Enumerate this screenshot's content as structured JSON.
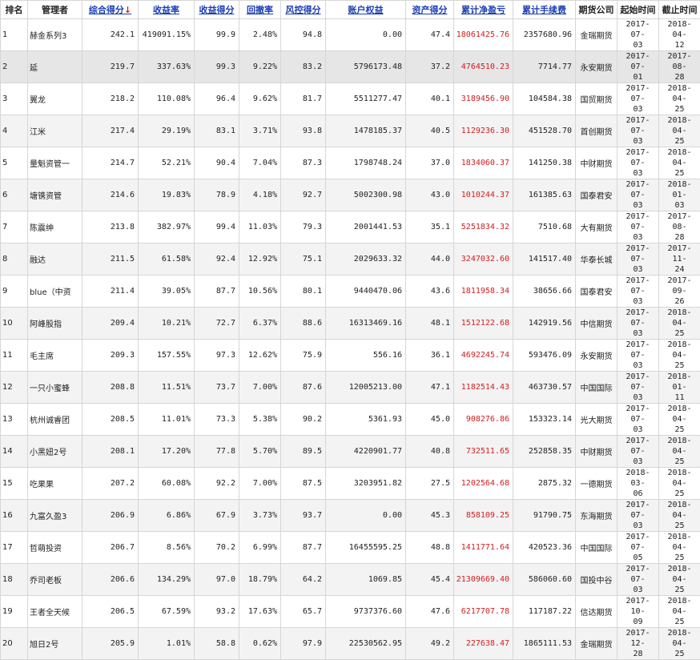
{
  "headers": {
    "rank": "排名",
    "manager": "管理者",
    "composite": "综合得分",
    "sort_arrow": "↓",
    "return_rate": "收益率",
    "return_score": "收益得分",
    "drawdown": "回撤率",
    "risk_score": "风控得分",
    "equity": "账户权益",
    "asset_score": "资产得分",
    "net_profit": "累计净盈亏",
    "fees": "累计手续费",
    "broker": "期货公司",
    "start": "起始时间",
    "end": "截止时间"
  },
  "rows": [
    {
      "rank": "1",
      "manager": "赫金系列3",
      "composite": "242.1",
      "ret": "419091.15%",
      "retScore": "99.9",
      "dd": "2.48%",
      "risk": "94.8",
      "equity": "0.00",
      "asset": "47.4",
      "profit": "18061425.76",
      "fee": "2357680.96",
      "broker": "金瑞期货",
      "start1": "2017-07-",
      "start2": "03",
      "end1": "2018-04-",
      "end2": "12"
    },
    {
      "rank": "2",
      "manager": "延",
      "composite": "219.7",
      "ret": "337.63%",
      "retScore": "99.3",
      "dd": "9.22%",
      "risk": "83.2",
      "equity": "5796173.48",
      "asset": "37.2",
      "profit": "4764510.23",
      "fee": "7714.77",
      "broker": "永安期货",
      "start1": "2017-07-",
      "start2": "01",
      "end1": "2017-08-",
      "end2": "28"
    },
    {
      "rank": "3",
      "manager": "翼龙",
      "composite": "218.2",
      "ret": "110.08%",
      "retScore": "96.4",
      "dd": "9.62%",
      "risk": "81.7",
      "equity": "5511277.47",
      "asset": "40.1",
      "profit": "3189456.90",
      "fee": "104584.38",
      "broker": "国贸期货",
      "start1": "2017-07-",
      "start2": "03",
      "end1": "2018-04-",
      "end2": "25"
    },
    {
      "rank": "4",
      "manager": "江米",
      "composite": "217.4",
      "ret": "29.19%",
      "retScore": "83.1",
      "dd": "3.71%",
      "risk": "93.8",
      "equity": "1478185.37",
      "asset": "40.5",
      "profit": "1129236.30",
      "fee": "451528.70",
      "broker": "首创期货",
      "start1": "2017-07-",
      "start2": "03",
      "end1": "2018-04-",
      "end2": "25"
    },
    {
      "rank": "5",
      "manager": "量魁资管一",
      "composite": "214.7",
      "ret": "52.21%",
      "retScore": "90.4",
      "dd": "7.04%",
      "risk": "87.3",
      "equity": "1798748.24",
      "asset": "37.0",
      "profit": "1834060.37",
      "fee": "141250.38",
      "broker": "中财期货",
      "start1": "2017-07-",
      "start2": "03",
      "end1": "2018-04-",
      "end2": "25"
    },
    {
      "rank": "6",
      "manager": "塘镌资管",
      "composite": "214.6",
      "ret": "19.83%",
      "retScore": "78.9",
      "dd": "4.18%",
      "risk": "92.7",
      "equity": "5002300.98",
      "asset": "43.0",
      "profit": "1010244.37",
      "fee": "161385.63",
      "broker": "国泰君安",
      "start1": "2017-07-",
      "start2": "03",
      "end1": "2018-01-",
      "end2": "03"
    },
    {
      "rank": "7",
      "manager": "陈震绅",
      "composite": "213.8",
      "ret": "382.97%",
      "retScore": "99.4",
      "dd": "11.03%",
      "risk": "79.3",
      "equity": "2001441.53",
      "asset": "35.1",
      "profit": "5251834.32",
      "fee": "7510.68",
      "broker": "大有期货",
      "start1": "2017-07-",
      "start2": "03",
      "end1": "2017-08-",
      "end2": "28"
    },
    {
      "rank": "8",
      "manager": "融达",
      "composite": "211.5",
      "ret": "61.58%",
      "retScore": "92.4",
      "dd": "12.92%",
      "risk": "75.1",
      "equity": "2029633.32",
      "asset": "44.0",
      "profit": "3247032.60",
      "fee": "141517.40",
      "broker": "华泰长城",
      "start1": "2017-07-",
      "start2": "03",
      "end1": "2017-11-",
      "end2": "24"
    },
    {
      "rank": "9",
      "manager": "blue（中资",
      "composite": "211.4",
      "ret": "39.05%",
      "retScore": "87.7",
      "dd": "10.56%",
      "risk": "80.1",
      "equity": "9440470.06",
      "asset": "43.6",
      "profit": "1811958.34",
      "fee": "38656.66",
      "broker": "国泰君安",
      "start1": "2017-07-",
      "start2": "03",
      "end1": "2017-09-",
      "end2": "26"
    },
    {
      "rank": "10",
      "manager": "阿峰股指",
      "composite": "209.4",
      "ret": "10.21%",
      "retScore": "72.7",
      "dd": "6.37%",
      "risk": "88.6",
      "equity": "16313469.16",
      "asset": "48.1",
      "profit": "1512122.68",
      "fee": "142919.56",
      "broker": "中信期货",
      "start1": "2017-07-",
      "start2": "03",
      "end1": "2018-04-",
      "end2": "25"
    },
    {
      "rank": "11",
      "manager": "毛主席",
      "composite": "209.3",
      "ret": "157.55%",
      "retScore": "97.3",
      "dd": "12.62%",
      "risk": "75.9",
      "equity": "556.16",
      "asset": "36.1",
      "profit": "4692245.74",
      "fee": "593476.09",
      "broker": "永安期货",
      "start1": "2017-07-",
      "start2": "03",
      "end1": "2018-04-",
      "end2": "25"
    },
    {
      "rank": "12",
      "manager": "一只小蜜蜂",
      "composite": "208.8",
      "ret": "11.51%",
      "retScore": "73.7",
      "dd": "7.00%",
      "risk": "87.6",
      "equity": "12005213.00",
      "asset": "47.1",
      "profit": "1182514.43",
      "fee": "463730.57",
      "broker": "中国国际",
      "start1": "2017-07-",
      "start2": "03",
      "end1": "2018-01-",
      "end2": "11"
    },
    {
      "rank": "13",
      "manager": "杭州诚睿团",
      "composite": "208.5",
      "ret": "11.01%",
      "retScore": "73.3",
      "dd": "5.38%",
      "risk": "90.2",
      "equity": "5361.93",
      "asset": "45.0",
      "profit": "908276.86",
      "fee": "153323.14",
      "broker": "光大期货",
      "start1": "2017-07-",
      "start2": "03",
      "end1": "2018-04-",
      "end2": "25"
    },
    {
      "rank": "14",
      "manager": "小黑妞2号",
      "composite": "208.1",
      "ret": "17.20%",
      "retScore": "77.8",
      "dd": "5.70%",
      "risk": "89.5",
      "equity": "4220901.77",
      "asset": "40.8",
      "profit": "732511.65",
      "fee": "252858.35",
      "broker": "中财期货",
      "start1": "2017-07-",
      "start2": "03",
      "end1": "2018-04-",
      "end2": "25"
    },
    {
      "rank": "15",
      "manager": "吃果果",
      "composite": "207.2",
      "ret": "60.08%",
      "retScore": "92.2",
      "dd": "7.00%",
      "risk": "87.5",
      "equity": "3203951.82",
      "asset": "27.5",
      "profit": "1202564.68",
      "fee": "2875.32",
      "broker": "一德期货",
      "start1": "2018-03-",
      "start2": "06",
      "end1": "2018-04-",
      "end2": "25"
    },
    {
      "rank": "16",
      "manager": "九富久盈3",
      "composite": "206.9",
      "ret": "6.86%",
      "retScore": "67.9",
      "dd": "3.73%",
      "risk": "93.7",
      "equity": "0.00",
      "asset": "45.3",
      "profit": "858109.25",
      "fee": "91790.75",
      "broker": "东海期货",
      "start1": "2017-07-",
      "start2": "03",
      "end1": "2018-04-",
      "end2": "25"
    },
    {
      "rank": "17",
      "manager": "哲萌投资",
      "composite": "206.7",
      "ret": "8.56%",
      "retScore": "70.2",
      "dd": "6.99%",
      "risk": "87.7",
      "equity": "16455595.25",
      "asset": "48.8",
      "profit": "1411771.64",
      "fee": "420523.36",
      "broker": "中国国际",
      "start1": "2017-07-",
      "start2": "05",
      "end1": "2018-04-",
      "end2": "25"
    },
    {
      "rank": "18",
      "manager": "乔司老板",
      "composite": "206.6",
      "ret": "134.29%",
      "retScore": "97.0",
      "dd": "18.79%",
      "risk": "64.2",
      "equity": "1069.85",
      "asset": "45.4",
      "profit": "21309669.40",
      "fee": "586060.60",
      "broker": "国投中谷",
      "start1": "2017-07-",
      "start2": "03",
      "end1": "2018-04-",
      "end2": "25"
    },
    {
      "rank": "19",
      "manager": "王者全天候",
      "composite": "206.5",
      "ret": "67.59%",
      "retScore": "93.2",
      "dd": "17.63%",
      "risk": "65.7",
      "equity": "9737376.60",
      "asset": "47.6",
      "profit": "6217707.78",
      "fee": "117187.22",
      "broker": "信达期货",
      "start1": "2017-10-",
      "start2": "09",
      "end1": "2018-04-",
      "end2": "25"
    },
    {
      "rank": "20",
      "manager": "旭日2号",
      "composite": "205.9",
      "ret": "1.01%",
      "retScore": "58.8",
      "dd": "0.62%",
      "risk": "97.9",
      "equity": "22530562.95",
      "asset": "49.2",
      "profit": "227638.47",
      "fee": "1865111.53",
      "broker": "金瑞期货",
      "start1": "2017-12-",
      "start2": "28",
      "end1": "2018-04-",
      "end2": "25"
    }
  ]
}
